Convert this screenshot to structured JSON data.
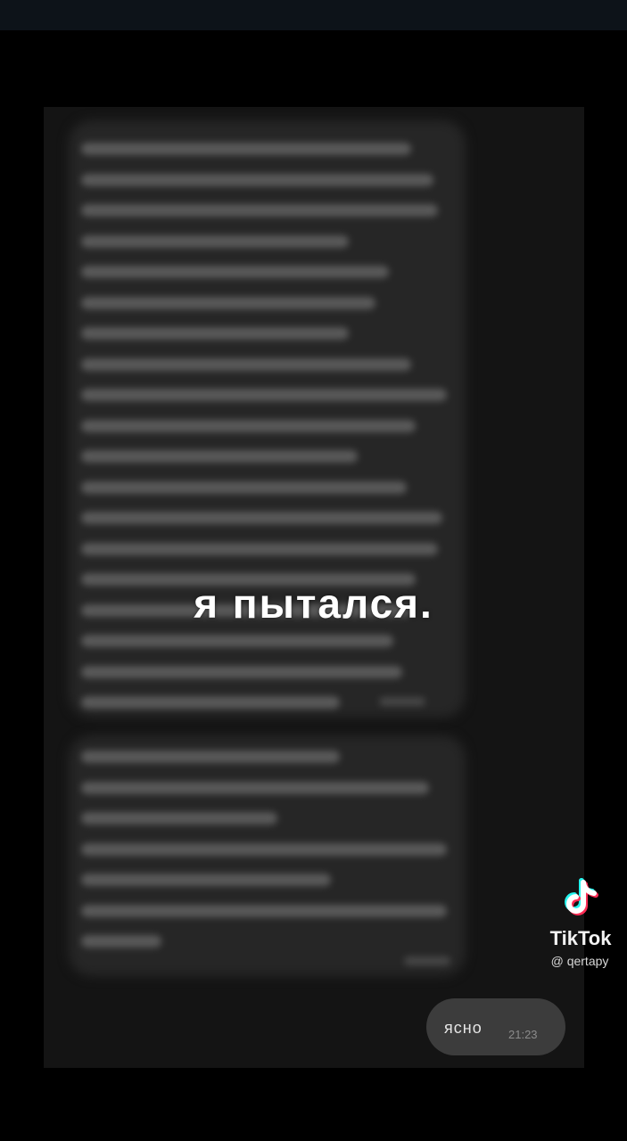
{
  "overlay": {
    "caption": "я пытался."
  },
  "chat": {
    "reply_text": "ясно",
    "reply_time": "21:23"
  },
  "watermark": {
    "logo": "tiktok-note-icon",
    "brand": "TikTok",
    "handle": "@ qertapy"
  },
  "colors": {
    "background": "#000000",
    "bubble": "#262626",
    "reply_bubble": "#3c3c3c",
    "tiktok_cyan": "#25f4ee",
    "tiktok_red": "#fe2c55"
  }
}
